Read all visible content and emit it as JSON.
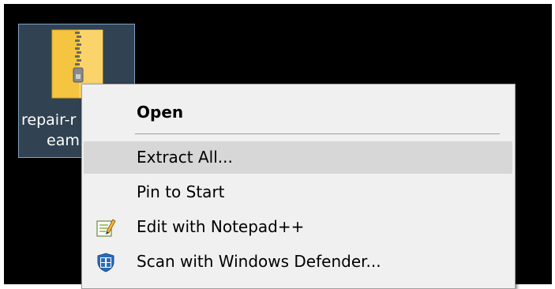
{
  "desktop": {
    "icon": {
      "name": "zip-archive",
      "label_line1": "repair-r",
      "label_line2": "eam."
    }
  },
  "context_menu": {
    "items": [
      {
        "label": "Open",
        "bold": true,
        "icon": null
      },
      {
        "label": "Extract All...",
        "highlighted": true,
        "icon": null
      },
      {
        "label": "Pin to Start",
        "icon": null
      },
      {
        "label": "Edit with Notepad++",
        "icon": "notepad-plus-plus-icon"
      },
      {
        "label": "Scan with Windows Defender...",
        "icon": "windows-defender-icon"
      }
    ]
  },
  "colors": {
    "desktop_background": "#000000",
    "menu_background": "#f0f0f0",
    "menu_highlight": "#d7d7d7",
    "selection": "#5a7896"
  }
}
